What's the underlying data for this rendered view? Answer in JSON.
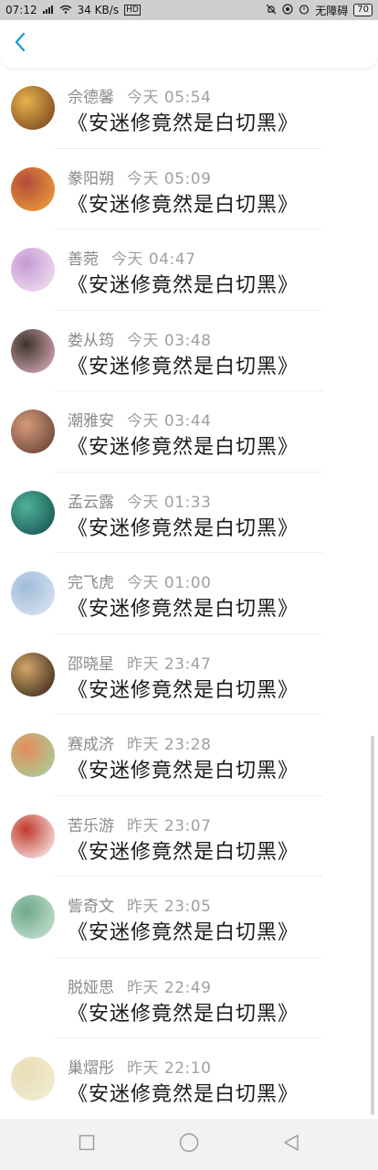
{
  "status_bar": {
    "time": "07:12",
    "network_speed": "34 KB/s",
    "hd_badge": "HD",
    "accessibility": "无障碍",
    "battery": "70"
  },
  "header": {
    "back_icon": "chevron-left-icon",
    "accent": "#1e9bd7"
  },
  "rows": [
    {
      "name": "佘德馨",
      "time": "今天 05:54",
      "message": "《安迷修竟然是白切黑》",
      "avatar_colors": [
        "#6b3b1c",
        "#e8b24a"
      ]
    },
    {
      "name": "豢阳朔",
      "time": "今天 05:09",
      "message": "《安迷修竟然是白切黑》",
      "avatar_colors": [
        "#f1a93b",
        "#b34b3a"
      ]
    },
    {
      "name": "善菀",
      "time": "今天 04:47",
      "message": "《安迷修竟然是白切黑》",
      "avatar_colors": [
        "#f4e8f2",
        "#c79ad6"
      ]
    },
    {
      "name": "娄从筠",
      "time": "今天 03:48",
      "message": "《安迷修竟然是白切黑》",
      "avatar_colors": [
        "#e9b8c8",
        "#3e3328"
      ]
    },
    {
      "name": "潮雅安",
      "time": "今天 03:44",
      "message": "《安迷修竟然是白切黑》",
      "avatar_colors": [
        "#5a3a2e",
        "#d79a7a"
      ]
    },
    {
      "name": "孟云露",
      "time": "今天 01:33",
      "message": "《安迷修竟然是白切黑》",
      "avatar_colors": [
        "#0f4a4a",
        "#4fb39a"
      ]
    },
    {
      "name": "完飞虎",
      "time": "今天 01:00",
      "message": "《安迷修竟然是白切黑》",
      "avatar_colors": [
        "#dfe9f3",
        "#9fbbd9"
      ]
    },
    {
      "name": "邵晓星",
      "time": "昨天 23:47",
      "message": "《安迷修竟然是白切黑》",
      "avatar_colors": [
        "#2b1d12",
        "#d3a56a"
      ]
    },
    {
      "name": "赛成济",
      "time": "昨天 23:28",
      "message": "《安迷修竟然是白切黑》",
      "avatar_colors": [
        "#9fd8a0",
        "#e58b5a"
      ]
    },
    {
      "name": "苦乐游",
      "time": "昨天 23:07",
      "message": "《安迷修竟然是白切黑》",
      "avatar_colors": [
        "#ffffff",
        "#c0392b"
      ]
    },
    {
      "name": "訾奇文",
      "time": "昨天 23:05",
      "message": "《安迷修竟然是白切黑》",
      "avatar_colors": [
        "#cfe6d8",
        "#6ea98a"
      ]
    },
    {
      "name": "脱娅思",
      "time": "昨天 22:49",
      "message": "《安迷修竟然是白切黑》",
      "avatar_colors": [
        "#ffffff",
        "#ffffff"
      ]
    },
    {
      "name": "巢熠彤",
      "time": "昨天 22:10",
      "message": "《安迷修竟然是白切黑》",
      "avatar_colors": [
        "#f3eed7",
        "#e7deb4"
      ]
    }
  ],
  "nav": {
    "recent_icon": "square-icon",
    "home_icon": "circle-icon",
    "back_icon": "triangle-back-icon"
  }
}
